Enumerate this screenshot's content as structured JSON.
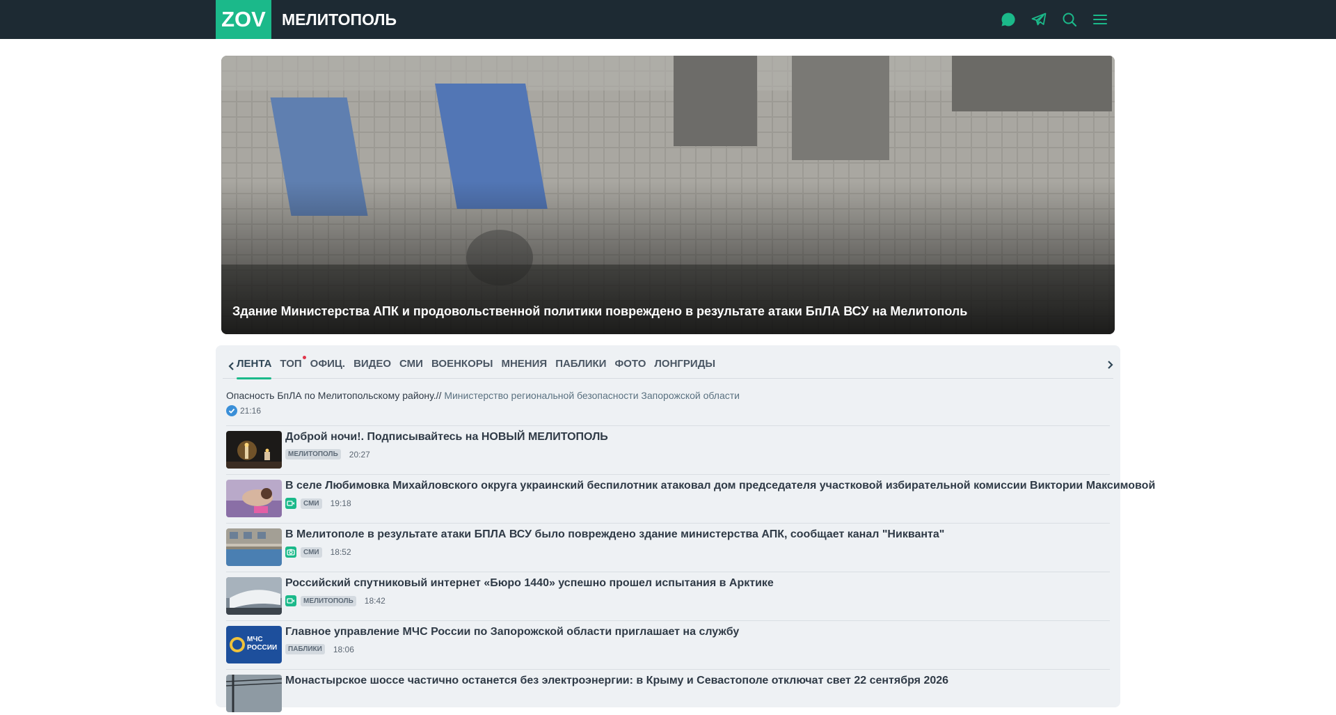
{
  "header": {
    "logo": "ZOV",
    "city": "МЕЛИТОПОЛЬ",
    "icons": [
      "chat-icon",
      "telegram-icon",
      "search-icon",
      "menu-icon"
    ]
  },
  "hero": {
    "title": "Здание Министерства АПК и продовольственной политики повреждено в результате атаки БпЛА ВСУ на Мелитополь"
  },
  "tabs": [
    {
      "label": "ЛЕНТА",
      "active": true
    },
    {
      "label": "ТОП",
      "dot": true
    },
    {
      "label": "ОФИЦ."
    },
    {
      "label": "ВИДЕО"
    },
    {
      "label": "СМИ"
    },
    {
      "label": "ВОЕНКОРЫ"
    },
    {
      "label": "МНЕНИЯ"
    },
    {
      "label": "ПАБЛИКИ"
    },
    {
      "label": "ФОТО"
    },
    {
      "label": "ЛОНГРИДЫ"
    }
  ],
  "urgent": {
    "text": "Опасность БпЛА по Мелитопольскому району.//",
    "source": "Министерство региональной безопасности Запорожской области",
    "time": "21:16"
  },
  "feed": [
    {
      "title": "Доброй ночи!. Подписывайтесь на НОВЫЙ МЕЛИТОПОЛЬ",
      "badge": "МЕЛИТОПОЛЬ",
      "time": "20:27",
      "media": "none",
      "thumb": "candles"
    },
    {
      "title": "В селе Любимовка Михайловского округа украинский беспилотник атаковал дом председателя участковой избирательной комиссии Виктории Максимовой",
      "badge": "СМИ",
      "time": "19:18",
      "media": "video",
      "thumb": "person"
    },
    {
      "title": "В Мелитополе в результате атаки БПЛА ВСУ было повреждено здание министерства АПК, сообщает канал \"Никванта\"",
      "badge": "СМИ",
      "time": "18:52",
      "media": "photo",
      "thumb": "building"
    },
    {
      "title": "Российский спутниковый интернет «Бюро 1440» успешно прошел испытания в Арктике",
      "badge": "МЕЛИТОПОЛЬ",
      "time": "18:42",
      "media": "video",
      "thumb": "satellite"
    },
    {
      "title": "Главное управление МЧС России по Запорожской области приглашает на службу",
      "badge": "ПАБЛИКИ",
      "time": "18:06",
      "media": "none",
      "thumb": "mchs",
      "thumb_text": "МЧС РОССИИ"
    },
    {
      "title": "Монастырское шоссе частично останется без электроэнергии: в Крыму и Севастополе отключат свет 22 сентября 2026",
      "badge": "",
      "time": "",
      "media": "none",
      "thumb": "power"
    }
  ],
  "colors": {
    "accent": "#1bb98a",
    "topbar": "#1d2a33",
    "panel": "#eef1f4",
    "dot": "#e0364b"
  }
}
